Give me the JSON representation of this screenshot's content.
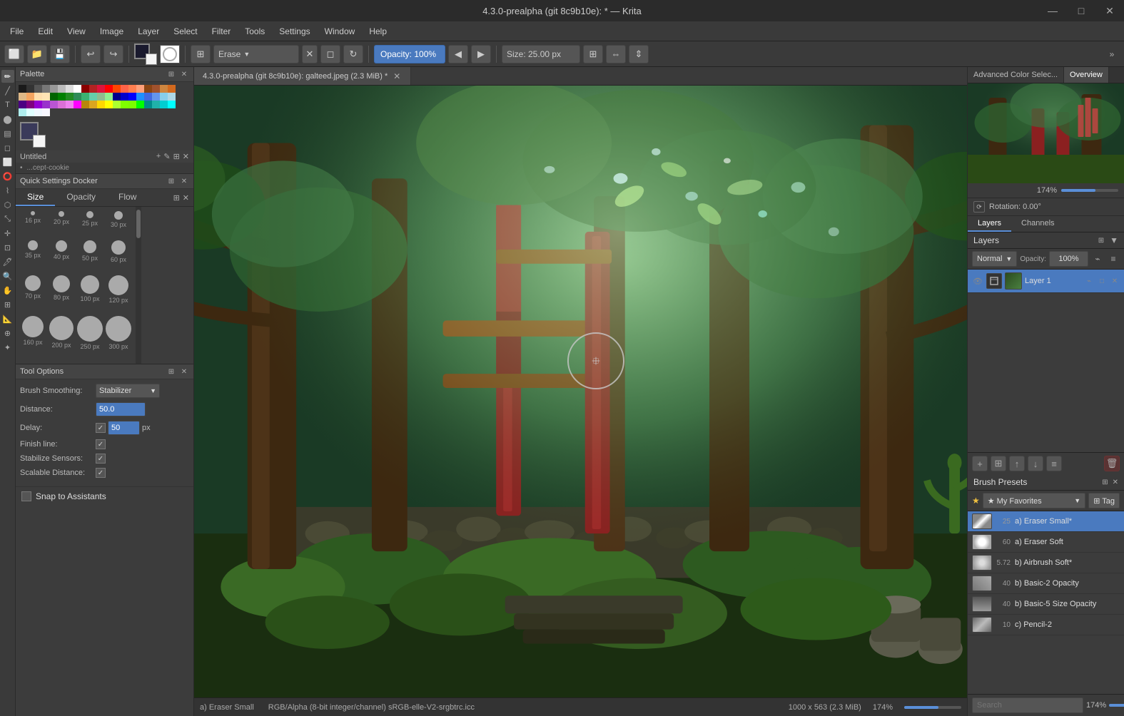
{
  "app": {
    "title": "4.3.0-prealpha (git 8c9b10e):  * — Krita",
    "file_tab": "4.3.0-prealpha (git 8c9b10e): galteed.jpeg (2.3 MiB) *"
  },
  "menu": {
    "items": [
      "File",
      "Edit",
      "View",
      "Image",
      "Layer",
      "Select",
      "Filter",
      "Tools",
      "Settings",
      "Window",
      "Help"
    ]
  },
  "toolbar": {
    "erase_label": "Erase",
    "opacity_label": "Opacity: 100%",
    "size_label": "Size: 25.00 px"
  },
  "palette": {
    "title": "Palette",
    "untitled_label": "Untitled",
    "cookie_label": "...cept-cookie"
  },
  "quick_settings": {
    "title": "Quick Settings Docker",
    "tabs": [
      "Size",
      "Opacity",
      "Flow"
    ],
    "brush_sizes": [
      {
        "size": 16,
        "label": "16 px",
        "circle": 6
      },
      {
        "size": 20,
        "label": "20 px",
        "circle": 8
      },
      {
        "size": 25,
        "label": "25 px",
        "circle": 10
      },
      {
        "size": 30,
        "label": "30 px",
        "circle": 12
      },
      {
        "size": 35,
        "label": "35 px",
        "circle": 14
      },
      {
        "size": 40,
        "label": "40 px",
        "circle": 16
      },
      {
        "size": 50,
        "label": "50 px",
        "circle": 18
      },
      {
        "size": 60,
        "label": "60 px",
        "circle": 20
      },
      {
        "size": 70,
        "label": "70 px",
        "circle": 22
      },
      {
        "size": 80,
        "label": "80 px",
        "circle": 24
      },
      {
        "size": 100,
        "label": "100 px",
        "circle": 26
      },
      {
        "size": 120,
        "label": "120 px",
        "circle": 28
      },
      {
        "size": 160,
        "label": "160 px",
        "circle": 30
      },
      {
        "size": 200,
        "label": "200 px",
        "circle": 34
      },
      {
        "size": 250,
        "label": "250 px",
        "circle": 38
      },
      {
        "size": 300,
        "label": "300 px",
        "circle": 42
      }
    ]
  },
  "tool_options": {
    "title": "Tool Options",
    "brush_smoothing_label": "Brush Smoothing:",
    "brush_smoothing_value": "Stabilizer",
    "distance_label": "Distance:",
    "distance_value": "50.0",
    "delay_label": "Delay:",
    "delay_value": "50",
    "delay_unit": "px",
    "finish_line_label": "Finish line:",
    "stabilize_sensors_label": "Stabilize Sensors:",
    "scalable_distance_label": "Scalable Distance:"
  },
  "snap": {
    "label": "Snap to Assistants"
  },
  "layers": {
    "title": "Layers",
    "tabs": [
      "Layers",
      "Channels"
    ],
    "blend_mode": "Normal",
    "opacity_label": "Opacity:  100%",
    "items": [
      {
        "name": "Layer 1",
        "visible": true,
        "active": true
      }
    ]
  },
  "overview": {
    "title": "Overview",
    "zoom_label": "174%",
    "rotation_label": "Rotation: 0.00°"
  },
  "advanced_color": {
    "title": "Advanced Color Selec..."
  },
  "brush_presets": {
    "title": "Brush Presets",
    "favorites_label": "★ My Favorites",
    "tag_label": "⊞ Tag",
    "items": [
      {
        "num": "25",
        "name": "a) Eraser Small*",
        "active": true
      },
      {
        "num": "60",
        "name": "a) Eraser Soft",
        "active": false
      },
      {
        "num": "5.72",
        "name": "b) Airbrush Soft*",
        "active": false
      },
      {
        "num": "40",
        "name": "b) Basic-2 Opacity",
        "active": false
      },
      {
        "num": "40",
        "name": "b) Basic-5 Size Opacity",
        "active": false
      },
      {
        "num": "10",
        "name": "c) Pencil-2",
        "active": false
      }
    ],
    "search_placeholder": "Search",
    "zoom_label": "174%"
  },
  "status_bar": {
    "brush_label": "a) Eraser Small",
    "color_mode": "RGB/Alpha (8-bit integer/channel)  sRGB-elle-V2-srgbtrc.icc",
    "dimensions": "1000 x 563 (2.3 MiB)",
    "zoom": "174%"
  },
  "win_controls": {
    "minimize": "—",
    "maximize": "□",
    "close": "✕"
  },
  "palette_colors": [
    "#1a1a1a",
    "#333",
    "#555",
    "#777",
    "#999",
    "#bbb",
    "#ddd",
    "#fff",
    "#8B0000",
    "#B22222",
    "#DC143C",
    "#FF0000",
    "#FF4500",
    "#FF6347",
    "#FF7F50",
    "#FFA07A",
    "#8B4513",
    "#A0522D",
    "#CD853F",
    "#D2691E",
    "#DEB887",
    "#F4A460",
    "#FFDEAD",
    "#FFE4B5",
    "#006400",
    "#008000",
    "#228B22",
    "#2E8B57",
    "#3CB371",
    "#66CDAA",
    "#8FBC8F",
    "#90EE90",
    "#00008B",
    "#0000CD",
    "#0000FF",
    "#1E90FF",
    "#4169E1",
    "#6495ED",
    "#87CEEB",
    "#ADD8E6",
    "#4B0082",
    "#800080",
    "#9400D3",
    "#9932CC",
    "#BA55D3",
    "#DA70D6",
    "#EE82EE",
    "#FF00FF",
    "#B8860B",
    "#DAA520",
    "#FFD700",
    "#FFFF00",
    "#ADFF2F",
    "#7FFF00",
    "#7CFC00",
    "#00FF00",
    "#008B8B",
    "#20B2AA",
    "#00CED1",
    "#00FFFF",
    "#AFEEEE",
    "#E0FFFF",
    "#F0F8FF",
    "#F8F8FF"
  ]
}
